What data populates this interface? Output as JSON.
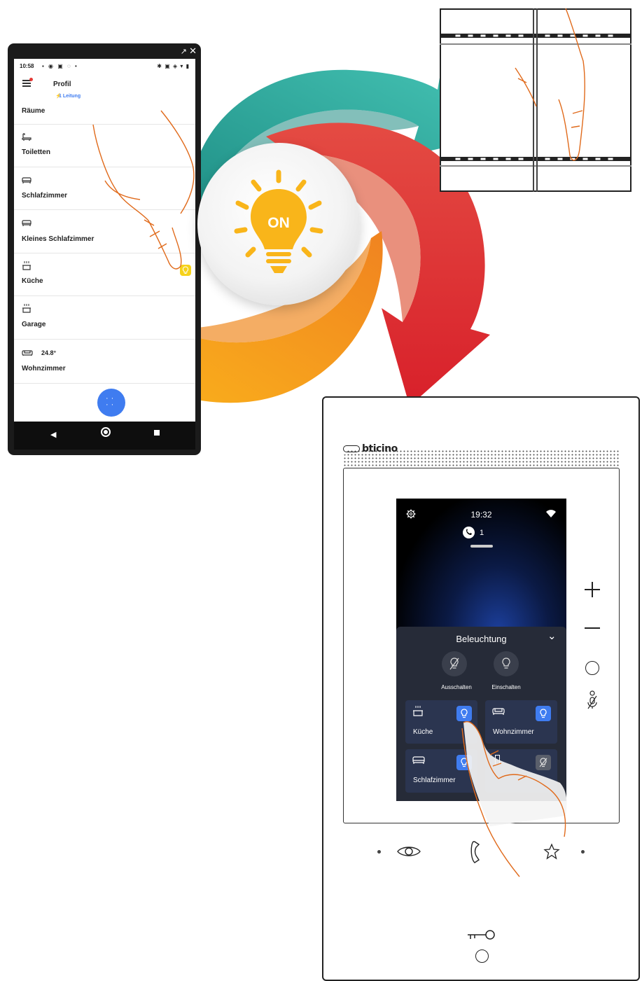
{
  "phone": {
    "status": {
      "time": "10:58"
    },
    "header": {
      "title": "Profil",
      "badge": "1 Leitung"
    },
    "section_title": "Räume",
    "rooms": [
      {
        "label": "Toiletten",
        "icon": "bathtub-icon"
      },
      {
        "label": "Schlafzimmer",
        "icon": "bed-icon"
      },
      {
        "label": "Kleines Schlafzimmer",
        "icon": "bed-icon"
      },
      {
        "label": "Küche",
        "icon": "cooking-pot-icon",
        "light": "on"
      },
      {
        "label": "Garage",
        "icon": "cooking-pot-icon"
      },
      {
        "label": "Wohnzimmer",
        "icon": "sofa-icon",
        "temperature": "24.8°"
      }
    ],
    "nav": [
      "back-icon",
      "home-icon",
      "recents-icon"
    ]
  },
  "center": {
    "label": "ON"
  },
  "intercom": {
    "brand": "bticino",
    "screen": {
      "time": "19:32",
      "call_count": "1",
      "panel_title": "Beleuchtung",
      "actions": [
        {
          "label": "Ausschalten",
          "icon": "light-off-icon"
        },
        {
          "label": "Einschalten",
          "icon": "light-on-icon"
        }
      ],
      "tiles": [
        {
          "label": "Küche",
          "icon": "cooking-pot-icon",
          "state": "on"
        },
        {
          "label": "Wohnzimmer",
          "icon": "sofa-icon",
          "state": "on"
        },
        {
          "label": "Schlafzimmer",
          "icon": "bed-icon",
          "state": "on"
        },
        {
          "label": "",
          "icon": "door-icon",
          "state": "off"
        }
      ]
    }
  },
  "colors": {
    "teal": "#2aa59a",
    "red": "#e0262b",
    "orange": "#f7a21b",
    "bulb": "#f9b51a",
    "accent_blue": "#3f7cf0",
    "finger_outline": "#e06a1b"
  }
}
